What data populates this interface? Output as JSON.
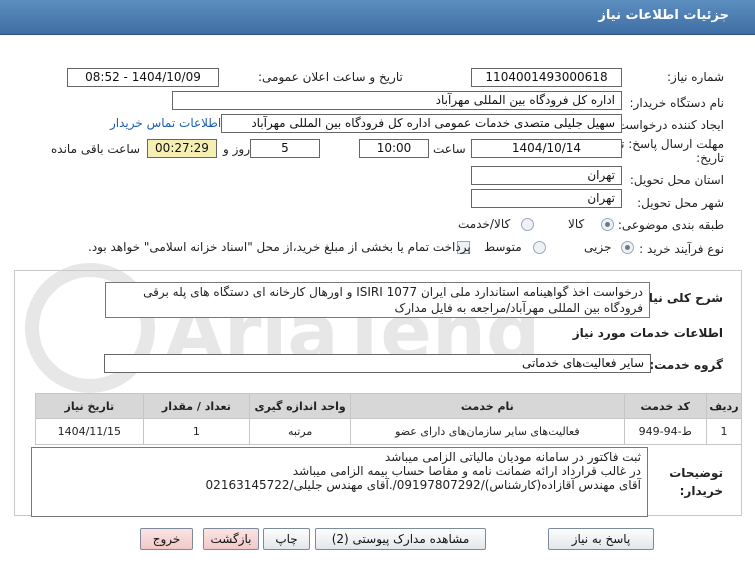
{
  "header": {
    "title": "جزئیات اطلاعات نیاز"
  },
  "form": {
    "need_number_label": "شماره نیاز:",
    "need_number": "1104001493000618",
    "announce_label": "تاریخ و ساعت اعلان عمومی:",
    "announce_value": "1404/10/09 - 08:52",
    "buyer_org_label": "نام دستگاه خریدار:",
    "buyer_org": "اداره کل فرودگاه بین المللی مهرآباد",
    "creator_label": "ایجاد کننده درخواست:",
    "creator": "سهیل جلیلی متصدی خدمات عمومی اداره کل فرودگاه بین المللی مهرآباد",
    "contact_link": "اطلاعات تماس خریدار",
    "deadline_label_1": "مهلت ارسال پاسخ: تا",
    "deadline_label_2": "تاریخ:",
    "deadline_date": "1404/10/14",
    "hour_label": "ساعت",
    "deadline_time": "10:00",
    "days_value": "5",
    "days_label": "روز و",
    "remaining_time": "00:27:29",
    "remaining_label": "ساعت باقی مانده",
    "province_label": "استان محل تحویل:",
    "province": "تهران",
    "city_label": "شهر محل تحویل:",
    "city": "تهران",
    "category_label": "طبقه بندی موضوعی:",
    "category_options": [
      "کالا",
      "کالا/خدمت"
    ],
    "process_label": "نوع فرآیند خرید :",
    "process_options": [
      "جزیی",
      "متوسط"
    ],
    "payment_note": "پرداخت تمام یا بخشی از مبلغ خرید،از محل \"اسناد خزانه اسلامی\" خواهد بود."
  },
  "description": {
    "label": "شرح کلی نیاز:",
    "text": "درخواست اخذ گواهینامه استاندارد ملی ایران ISIRI 1077 و اورهال کارخانه ای دستگاه های پله برقی فرودگاه بین المللی مهرآباد/مراجعه به فایل مدارک"
  },
  "services": {
    "section_title": "اطلاعات خدمات مورد نیاز",
    "group_label": "گروه خدمت:",
    "group_value": "سایر فعالیت‌های خدماتی",
    "columns": [
      "ردیف",
      "کد خدمت",
      "نام خدمت",
      "واحد اندازه گیری",
      "تعداد / مقدار",
      "تاریخ نیاز"
    ],
    "rows": [
      [
        "1",
        "ط-94-949",
        "فعالیت‌های سایر سازمان‌های دارای عضو",
        "مرتبه",
        "1",
        "1404/11/15"
      ]
    ]
  },
  "notes": {
    "label": "توضیحات خریدار:",
    "lines": [
      "ثبت فاکتور در سامانه مودیان مالیاتی الزامی میباشد",
      "در غالب قرارداد ارائه ضمانت نامه و مفاصا حساب بیمه الزامی میباشد",
      "آقای مهندس آقازاده(کارشناس)/09197807292/.آقای مهندس جلیلی/02163145722"
    ]
  },
  "buttons": {
    "reply": "پاسخ به نیاز",
    "attachments": "مشاهده مدارک پیوستی (2)",
    "print": "چاپ",
    "back": "بازگشت",
    "exit": "خروج"
  },
  "watermark": {
    "text": "AriaTender.net"
  }
}
